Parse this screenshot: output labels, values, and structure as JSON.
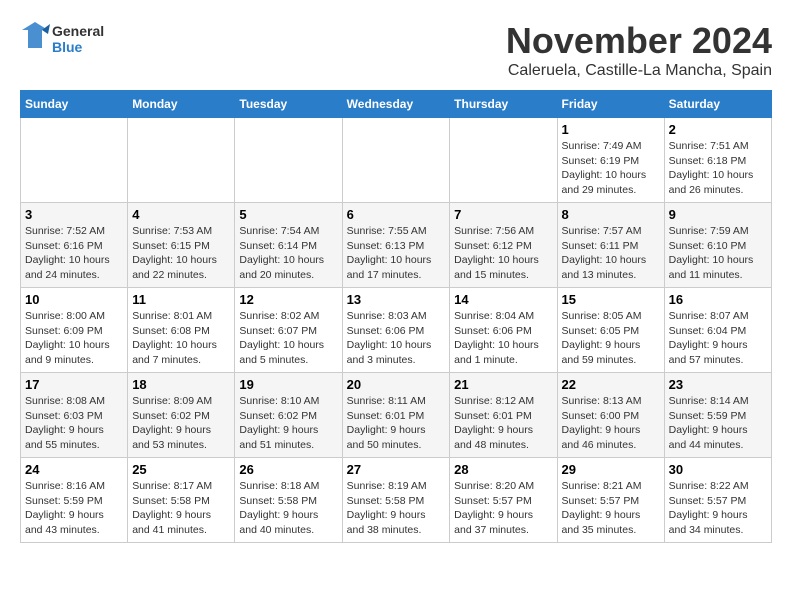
{
  "header": {
    "logo_line1": "General",
    "logo_line2": "Blue",
    "month": "November 2024",
    "location": "Caleruela, Castille-La Mancha, Spain"
  },
  "weekdays": [
    "Sunday",
    "Monday",
    "Tuesday",
    "Wednesday",
    "Thursday",
    "Friday",
    "Saturday"
  ],
  "weeks": [
    [
      {
        "day": "",
        "info": ""
      },
      {
        "day": "",
        "info": ""
      },
      {
        "day": "",
        "info": ""
      },
      {
        "day": "",
        "info": ""
      },
      {
        "day": "",
        "info": ""
      },
      {
        "day": "1",
        "info": "Sunrise: 7:49 AM\nSunset: 6:19 PM\nDaylight: 10 hours and 29 minutes."
      },
      {
        "day": "2",
        "info": "Sunrise: 7:51 AM\nSunset: 6:18 PM\nDaylight: 10 hours and 26 minutes."
      }
    ],
    [
      {
        "day": "3",
        "info": "Sunrise: 7:52 AM\nSunset: 6:16 PM\nDaylight: 10 hours and 24 minutes."
      },
      {
        "day": "4",
        "info": "Sunrise: 7:53 AM\nSunset: 6:15 PM\nDaylight: 10 hours and 22 minutes."
      },
      {
        "day": "5",
        "info": "Sunrise: 7:54 AM\nSunset: 6:14 PM\nDaylight: 10 hours and 20 minutes."
      },
      {
        "day": "6",
        "info": "Sunrise: 7:55 AM\nSunset: 6:13 PM\nDaylight: 10 hours and 17 minutes."
      },
      {
        "day": "7",
        "info": "Sunrise: 7:56 AM\nSunset: 6:12 PM\nDaylight: 10 hours and 15 minutes."
      },
      {
        "day": "8",
        "info": "Sunrise: 7:57 AM\nSunset: 6:11 PM\nDaylight: 10 hours and 13 minutes."
      },
      {
        "day": "9",
        "info": "Sunrise: 7:59 AM\nSunset: 6:10 PM\nDaylight: 10 hours and 11 minutes."
      }
    ],
    [
      {
        "day": "10",
        "info": "Sunrise: 8:00 AM\nSunset: 6:09 PM\nDaylight: 10 hours and 9 minutes."
      },
      {
        "day": "11",
        "info": "Sunrise: 8:01 AM\nSunset: 6:08 PM\nDaylight: 10 hours and 7 minutes."
      },
      {
        "day": "12",
        "info": "Sunrise: 8:02 AM\nSunset: 6:07 PM\nDaylight: 10 hours and 5 minutes."
      },
      {
        "day": "13",
        "info": "Sunrise: 8:03 AM\nSunset: 6:06 PM\nDaylight: 10 hours and 3 minutes."
      },
      {
        "day": "14",
        "info": "Sunrise: 8:04 AM\nSunset: 6:06 PM\nDaylight: 10 hours and 1 minute."
      },
      {
        "day": "15",
        "info": "Sunrise: 8:05 AM\nSunset: 6:05 PM\nDaylight: 9 hours and 59 minutes."
      },
      {
        "day": "16",
        "info": "Sunrise: 8:07 AM\nSunset: 6:04 PM\nDaylight: 9 hours and 57 minutes."
      }
    ],
    [
      {
        "day": "17",
        "info": "Sunrise: 8:08 AM\nSunset: 6:03 PM\nDaylight: 9 hours and 55 minutes."
      },
      {
        "day": "18",
        "info": "Sunrise: 8:09 AM\nSunset: 6:02 PM\nDaylight: 9 hours and 53 minutes."
      },
      {
        "day": "19",
        "info": "Sunrise: 8:10 AM\nSunset: 6:02 PM\nDaylight: 9 hours and 51 minutes."
      },
      {
        "day": "20",
        "info": "Sunrise: 8:11 AM\nSunset: 6:01 PM\nDaylight: 9 hours and 50 minutes."
      },
      {
        "day": "21",
        "info": "Sunrise: 8:12 AM\nSunset: 6:01 PM\nDaylight: 9 hours and 48 minutes."
      },
      {
        "day": "22",
        "info": "Sunrise: 8:13 AM\nSunset: 6:00 PM\nDaylight: 9 hours and 46 minutes."
      },
      {
        "day": "23",
        "info": "Sunrise: 8:14 AM\nSunset: 5:59 PM\nDaylight: 9 hours and 44 minutes."
      }
    ],
    [
      {
        "day": "24",
        "info": "Sunrise: 8:16 AM\nSunset: 5:59 PM\nDaylight: 9 hours and 43 minutes."
      },
      {
        "day": "25",
        "info": "Sunrise: 8:17 AM\nSunset: 5:58 PM\nDaylight: 9 hours and 41 minutes."
      },
      {
        "day": "26",
        "info": "Sunrise: 8:18 AM\nSunset: 5:58 PM\nDaylight: 9 hours and 40 minutes."
      },
      {
        "day": "27",
        "info": "Sunrise: 8:19 AM\nSunset: 5:58 PM\nDaylight: 9 hours and 38 minutes."
      },
      {
        "day": "28",
        "info": "Sunrise: 8:20 AM\nSunset: 5:57 PM\nDaylight: 9 hours and 37 minutes."
      },
      {
        "day": "29",
        "info": "Sunrise: 8:21 AM\nSunset: 5:57 PM\nDaylight: 9 hours and 35 minutes."
      },
      {
        "day": "30",
        "info": "Sunrise: 8:22 AM\nSunset: 5:57 PM\nDaylight: 9 hours and 34 minutes."
      }
    ]
  ]
}
